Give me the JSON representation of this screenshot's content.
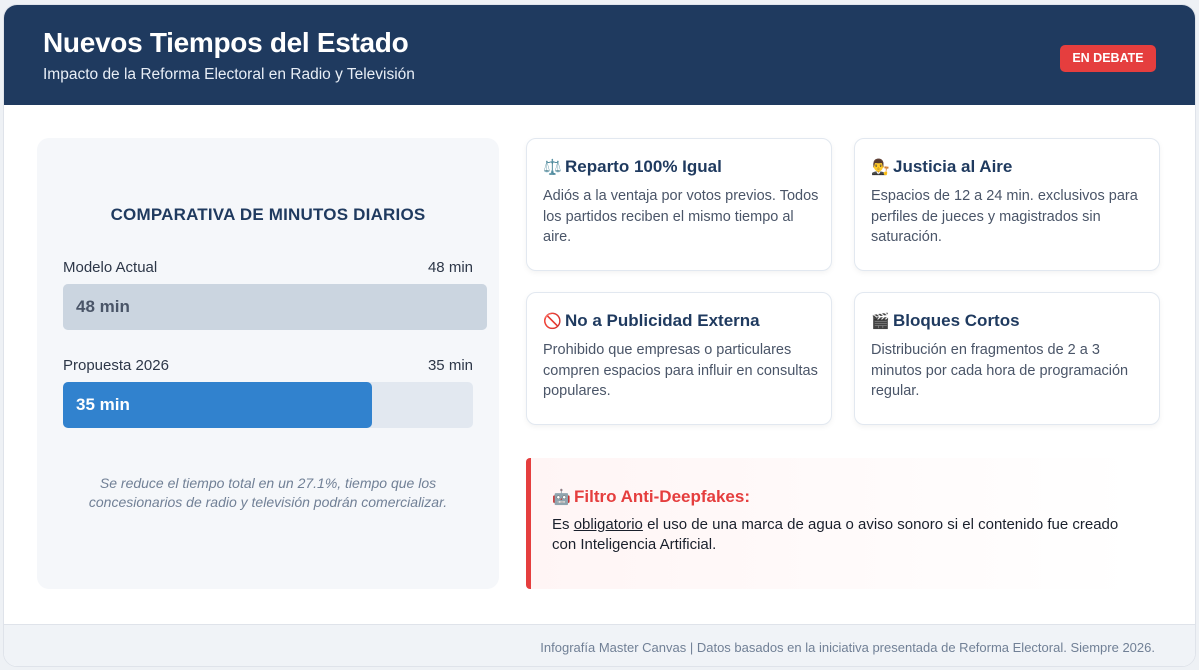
{
  "header": {
    "title": "Nuevos Tiempos del Estado",
    "subtitle": "Impacto de la Reforma Electoral en Radio y Televisión",
    "badge": "EN DEBATE"
  },
  "comparison": {
    "title": "COMPARATIVA DE MINUTOS DIARIOS",
    "rows": [
      {
        "label": "Modelo Actual",
        "value_text": "48 min",
        "bar_text": "48 min",
        "minutes": 48,
        "fill_fraction": 1.0
      },
      {
        "label": "Propuesta 2026",
        "value_text": "35 min",
        "bar_text": "35 min",
        "minutes": 35,
        "fill_fraction": 0.7292
      }
    ],
    "note": "Se reduce el tiempo total en un 27.1%, tiempo que los concesionarios de radio y televisión podrán comercializar."
  },
  "cards": [
    {
      "icon": "scales-icon",
      "glyph": "⚖️",
      "title": "Reparto 100% Igual",
      "text": "Adiós a la ventaja por votos previos. Todos los partidos reciben el mismo tiempo al aire."
    },
    {
      "icon": "judge-icon",
      "glyph": "👨‍⚖️",
      "title": "Justicia al Aire",
      "text": "Espacios de 12 a 24 min. exclusivos para perfiles de jueces y magistrados sin saturación."
    },
    {
      "icon": "prohibited-icon",
      "glyph": "🚫",
      "title": "No a Publicidad Externa",
      "text": "Prohibido que empresas o particulares compren espacios para influir en consultas populares."
    },
    {
      "icon": "clapperboard-icon",
      "glyph": "🎬",
      "title": "Bloques Cortos",
      "text": "Distribución en fragmentos de 2 a 3 minutos por cada hora de programación regular."
    }
  ],
  "alert": {
    "icon": "robot-icon",
    "glyph": "🤖",
    "title": "Filtro Anti-Deepfakes:",
    "text_before": "Es ",
    "text_emphasis": "obligatorio",
    "text_after": " el uso de una marca de agua o aviso sonoro si el contenido fue creado con Inteligencia Artificial."
  },
  "footer": {
    "text": "Infografía Master Canvas | Datos basados en la iniciativa presentada de Reforma Electoral. Siempre 2026."
  },
  "colors": {
    "header_bg": "#1f3a5f",
    "badge_bg": "#e53e3e",
    "bar_current": "#cbd5e0",
    "bar_proposal": "#3182ce",
    "alert_accent": "#e53e3e"
  }
}
